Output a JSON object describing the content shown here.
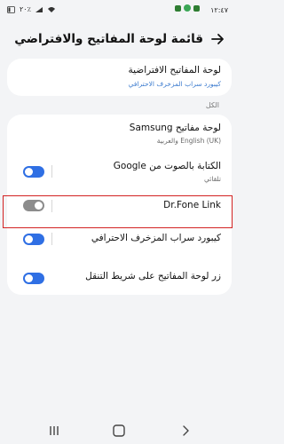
{
  "status_bar": {
    "time": "١٢:٤٧",
    "battery": "٢٠٪"
  },
  "header": {
    "title": "قائمة لوحة المفاتيح والافتراضي"
  },
  "default_keyboard": {
    "title": "لوحة المفاتيح الافتراضية",
    "value": "كيبورد سراب المزخرف الاحترافي"
  },
  "section_all": "الكل",
  "keyboards": [
    {
      "title": "لوحة مفاتيح Samsung",
      "subtitle": "English (UK) والعربية"
    },
    {
      "title": "الكتابة بالصوت من Google",
      "subtitle": "تلقائي",
      "enabled": true
    },
    {
      "title": "Dr.Fone Link",
      "enabled": false
    },
    {
      "title": "كيبورد سراب المزخرف الاحترافي",
      "enabled": true
    }
  ],
  "navbar_keyboard_button": {
    "title": "زر لوحة المفاتيح على شريط التنقل",
    "enabled": true
  },
  "colors": {
    "toggle_on": "#2f6fe4",
    "toggle_off": "#8c8c8c",
    "highlight": "#d32222"
  }
}
